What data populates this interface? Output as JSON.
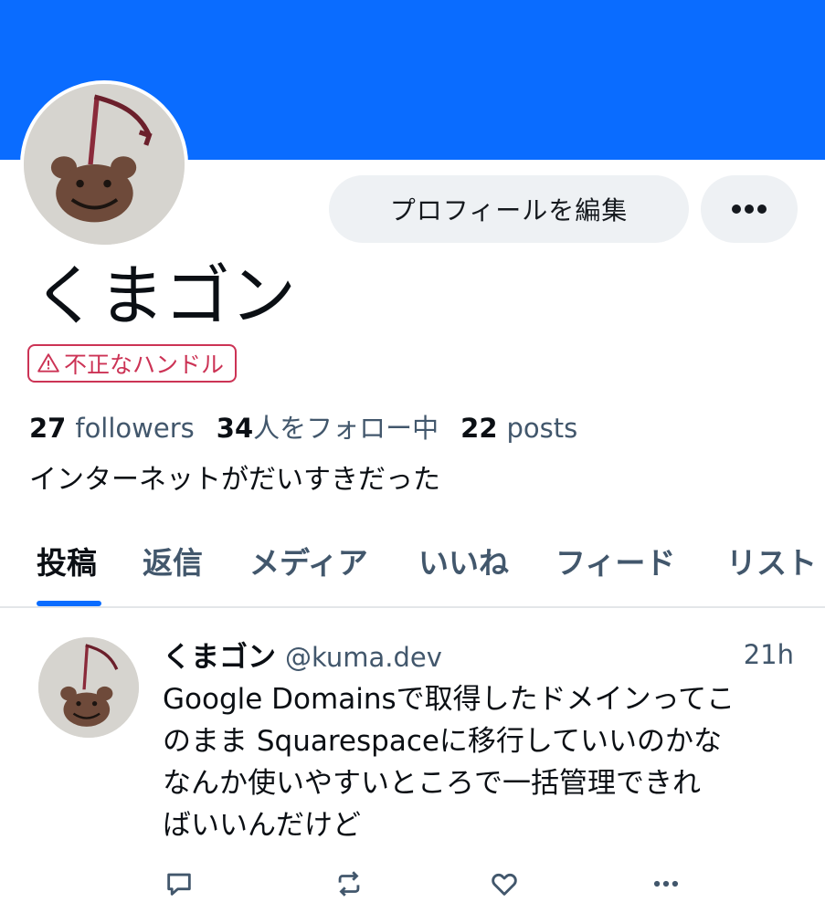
{
  "profile": {
    "display_name": "くまゴン",
    "badge": "不正なハンドル",
    "bio": "インターネットがだいすきだった",
    "banner_color": "#0a6cff",
    "stats": {
      "followers_count": "27",
      "followers_label": "followers",
      "following_count": "34",
      "following_label": "人をフォロー中",
      "posts_count": "22",
      "posts_label": "posts"
    }
  },
  "buttons": {
    "edit_profile": "プロフィールを編集",
    "more": "more-icon"
  },
  "tabs": [
    {
      "label": "投稿",
      "active": true
    },
    {
      "label": "返信",
      "active": false
    },
    {
      "label": "メディア",
      "active": false
    },
    {
      "label": "いいね",
      "active": false
    },
    {
      "label": "フィード",
      "active": false
    },
    {
      "label": "リスト",
      "active": false
    }
  ],
  "post": {
    "author_name": "くまゴン",
    "author_handle": "@kuma.dev",
    "time": "21h",
    "lines": [
      "Google Domainsで取得したドメインってこ",
      "のまま Squarespaceに移行していいのかな",
      "なんか使いやすいところで一括管理できれ",
      "ばいいんだけど"
    ],
    "actions": [
      "reply-icon",
      "repost-icon",
      "like-icon",
      "more-icon"
    ]
  },
  "colors": {
    "accent": "#0a6cff",
    "muted_text": "#42576c",
    "warning": "#cc3355",
    "button_bg": "#eef1f4"
  }
}
